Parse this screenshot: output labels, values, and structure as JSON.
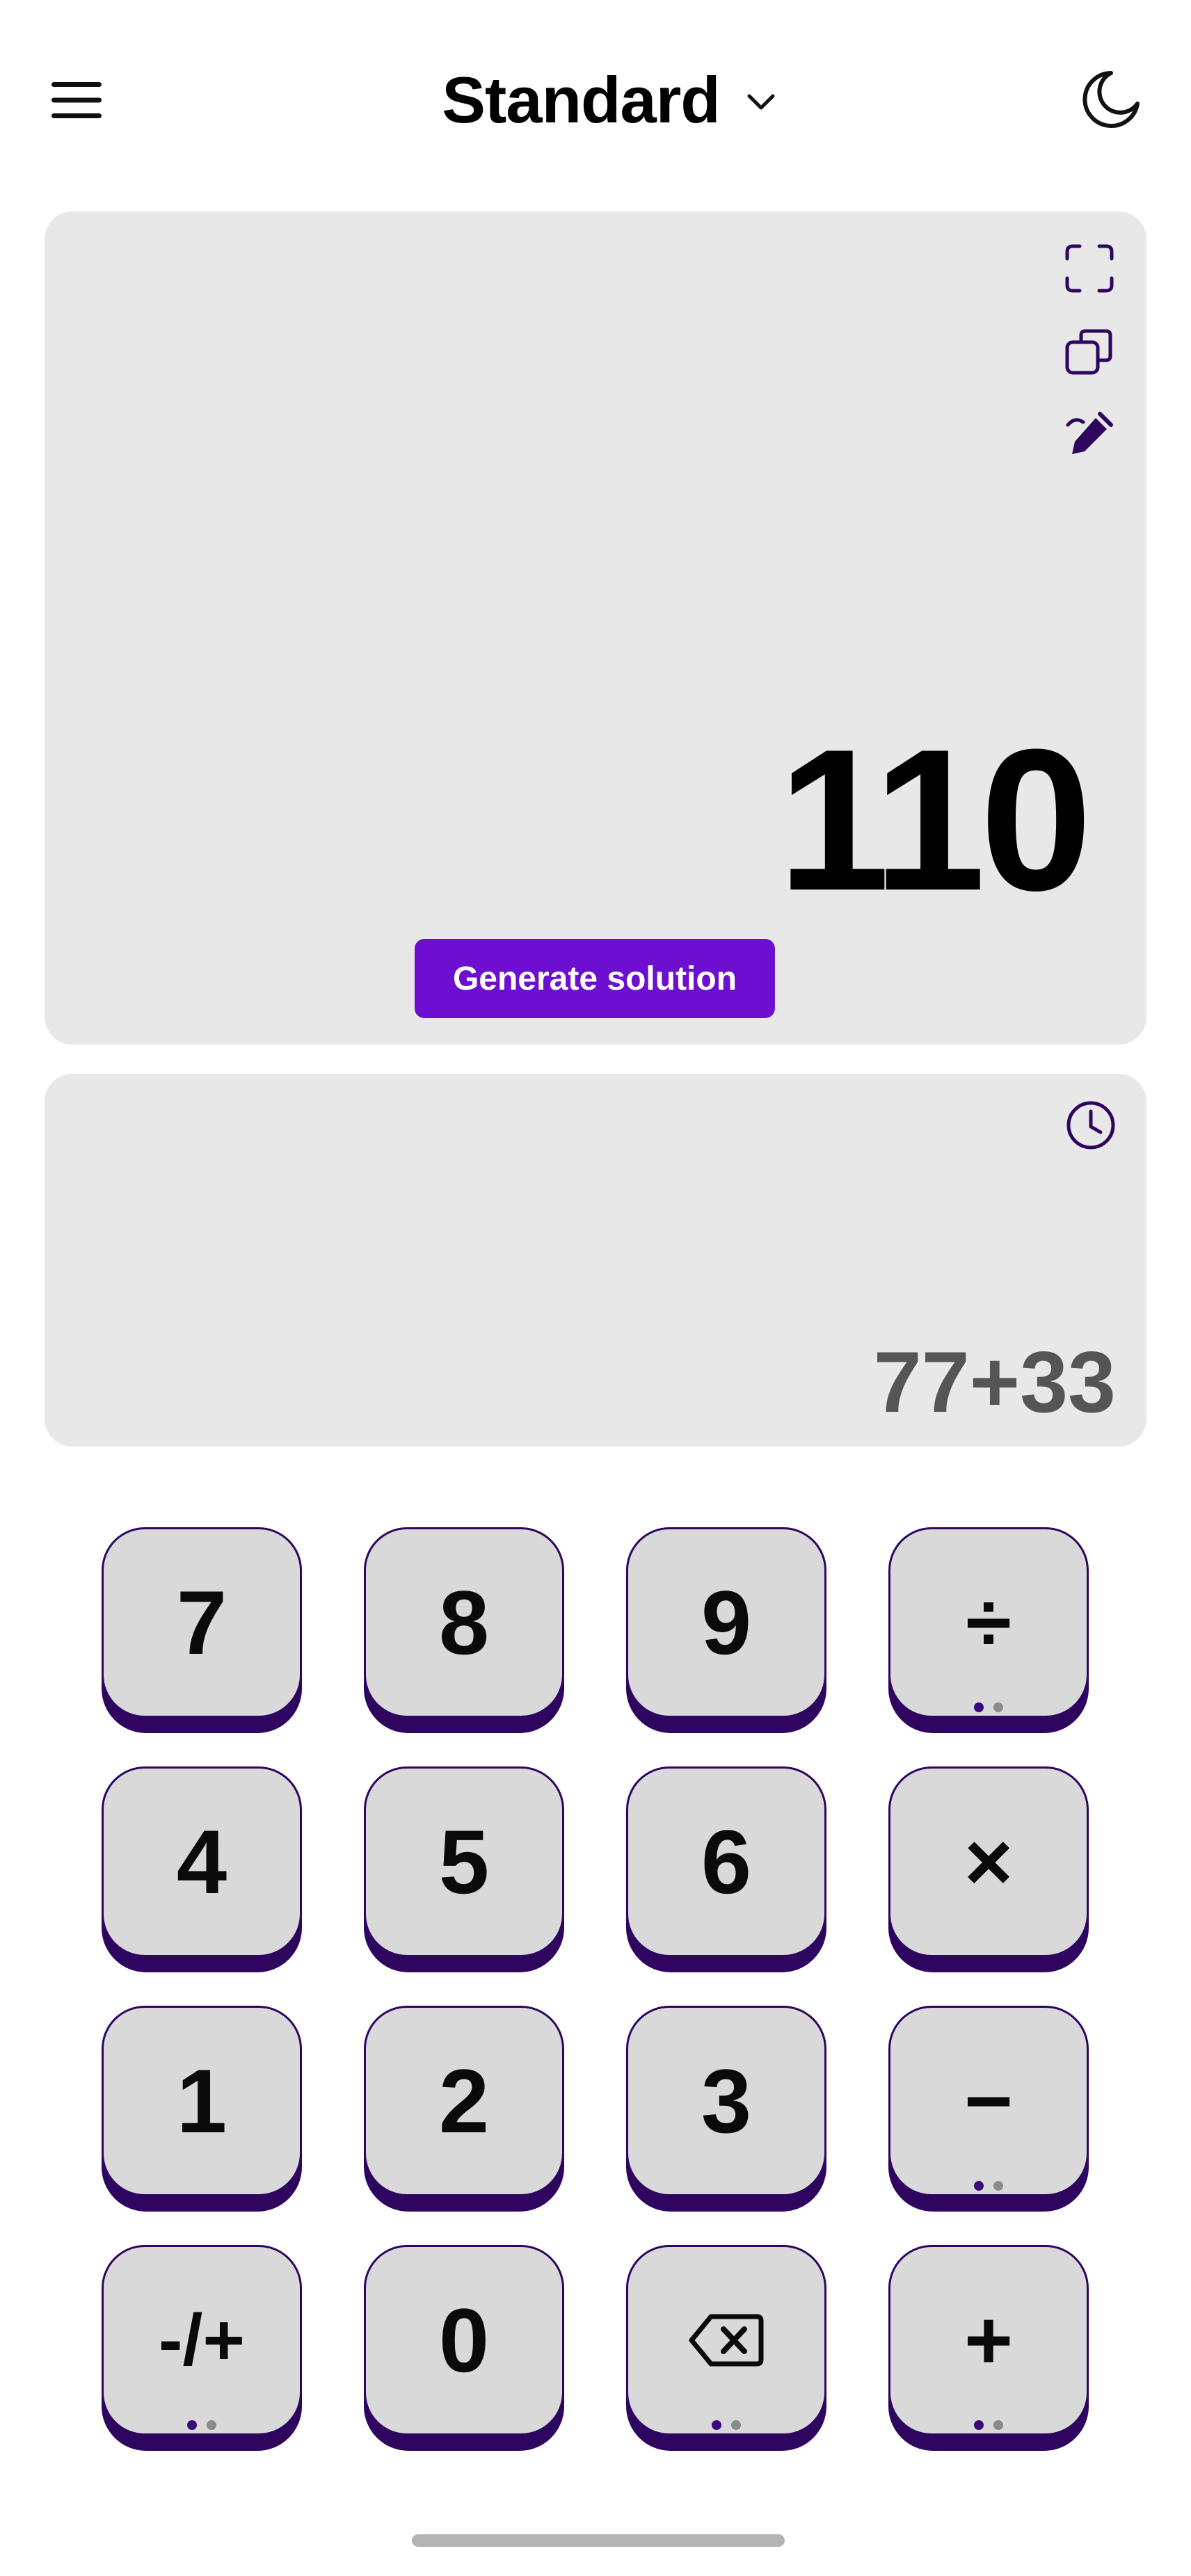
{
  "header": {
    "title": "Standard",
    "menu_icon": "hamburger-menu-icon",
    "dropdown_icon": "chevron-down-icon",
    "theme_icon": "moon-icon"
  },
  "result": {
    "value": "110",
    "generate_label": "Generate solution",
    "icons": [
      "fullscreen-icon",
      "copy-icon",
      "edit-icon"
    ]
  },
  "history": {
    "expression": "77+33",
    "icon": "clock-icon"
  },
  "keypad": {
    "keys": [
      {
        "label": "7",
        "dots": false
      },
      {
        "label": "8",
        "dots": false
      },
      {
        "label": "9",
        "dots": false
      },
      {
        "label": "÷",
        "dots": true
      },
      {
        "label": "4",
        "dots": false
      },
      {
        "label": "5",
        "dots": false
      },
      {
        "label": "6",
        "dots": false
      },
      {
        "label": "×",
        "dots": false
      },
      {
        "label": "1",
        "dots": false
      },
      {
        "label": "2",
        "dots": false
      },
      {
        "label": "3",
        "dots": false
      },
      {
        "label": "−",
        "dots": true
      },
      {
        "label": "-/+",
        "dots": true
      },
      {
        "label": "0",
        "dots": false
      },
      {
        "label": "",
        "icon": "backspace-icon",
        "dots": true
      },
      {
        "label": "+",
        "dots": true
      }
    ]
  },
  "colors": {
    "accent": "#6c0fd1",
    "key_border": "#2e0660",
    "key_face": "#d9d9d9",
    "panel_bg": "#e8e8e8"
  }
}
